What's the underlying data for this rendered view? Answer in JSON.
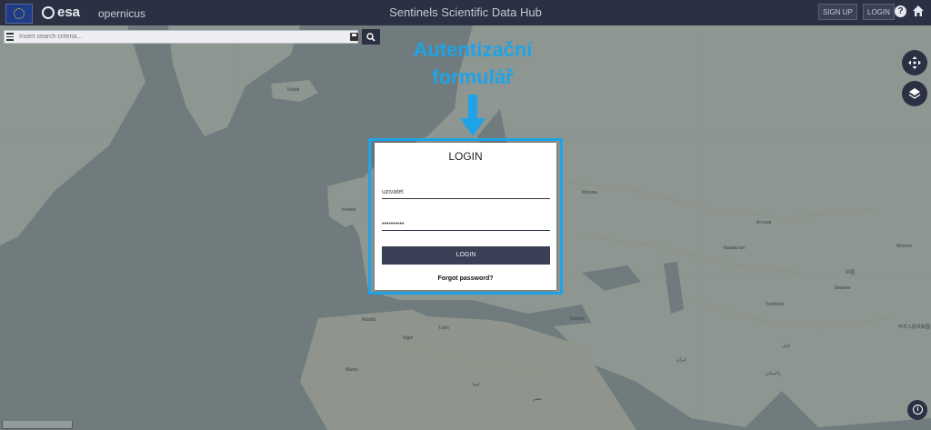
{
  "header": {
    "brand_esa": "esa",
    "brand_copernicus": "opernicus",
    "title": "Sentinels Scientific Data Hub",
    "signup_label": "SIGN UP",
    "login_label": "LOGIN",
    "help_icon": "?",
    "home_icon": "home-icon"
  },
  "search": {
    "placeholder": "Insert search criteria...",
    "menu_icon": "menu-icon",
    "save_icon": "save-icon",
    "search_icon": "search-icon"
  },
  "map_controls": {
    "pan_icon": "move-arrows-icon",
    "layers_icon": "layers-icon",
    "info_icon": "info-icon"
  },
  "annotation": {
    "line1": "Autentizační",
    "line2": "formulář"
  },
  "login_form": {
    "title": "LOGIN",
    "username_value": "uzivatel",
    "password_value": "••••••••••",
    "submit_label": "LOGIN",
    "forgot_label": "Forgot password?"
  },
  "map_labels": {
    "iceland": "Ísland",
    "ireland": "Ireland",
    "moscow": "Москва",
    "astana": "Астана",
    "algeria": "Alger",
    "turkey": "Türkiye",
    "egypt": "مصر",
    "iran": "ایران",
    "pakistan": "پاکستان",
    "china": "中国",
    "kazakhstan": "Қазақстан",
    "mongolia": "Монгол",
    "bishkek": "Бишкек",
    "tashkent": "Toshkent",
    "kabul": "کابل",
    "madrid": "Madrid",
    "maroc": "Maroc",
    "tunis": "Tunis",
    "libya": "ليبيا",
    "beijing": "中华人民共和国"
  },
  "colors": {
    "header_bg": "#2b3142",
    "annotation": "#1fa3e8",
    "login_button": "#3a3f55"
  }
}
